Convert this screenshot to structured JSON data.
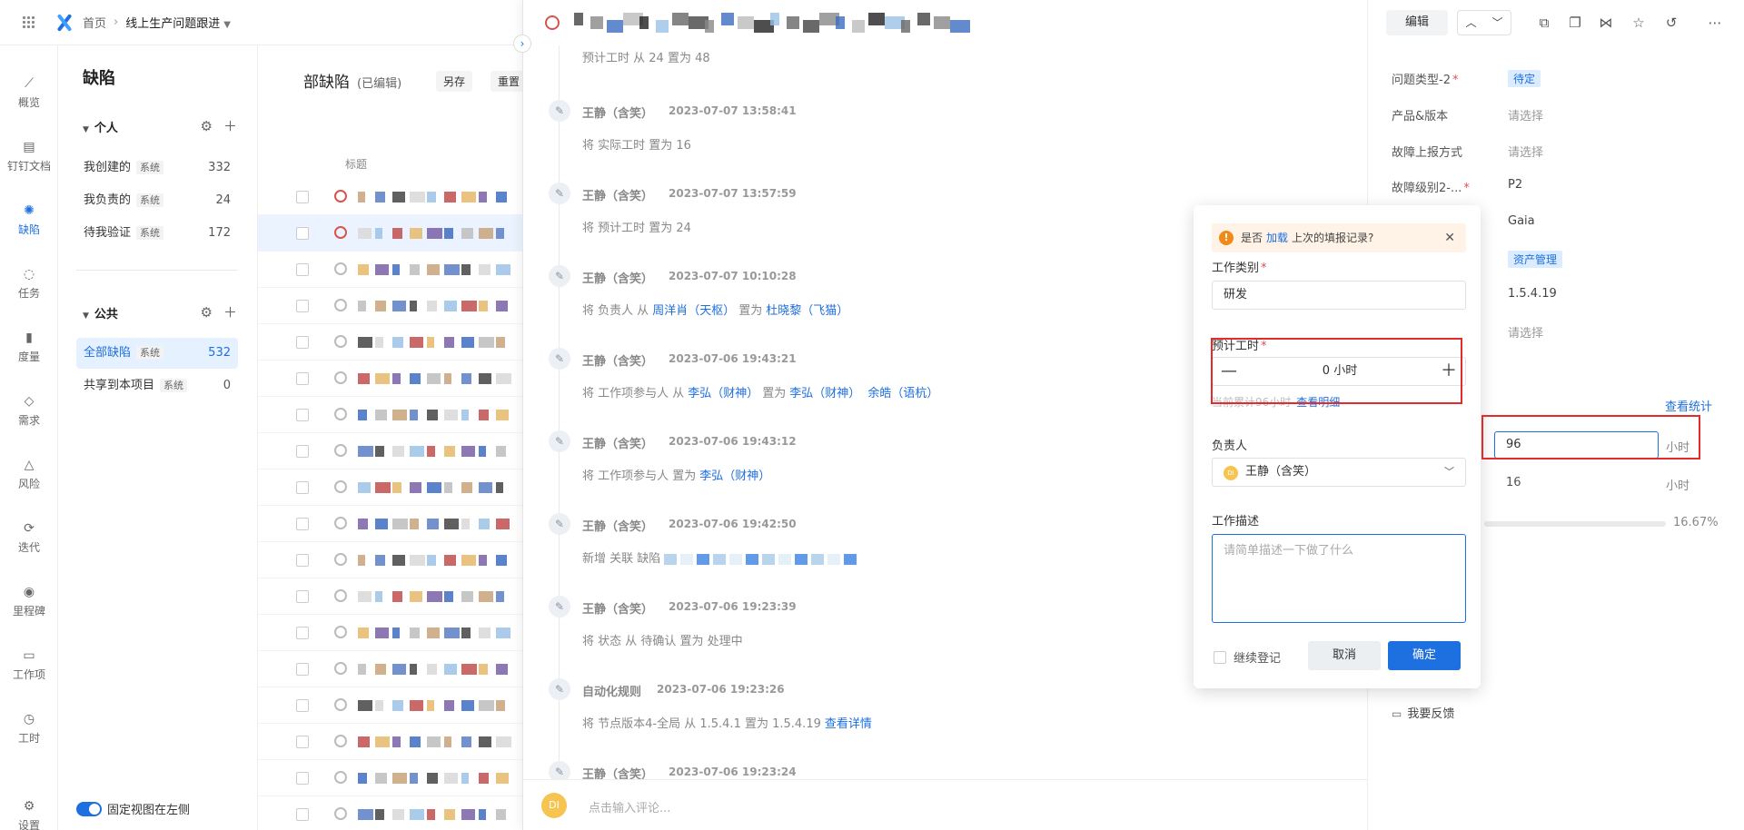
{
  "topbar": {
    "home": "首页",
    "project": "线上生产问题跟进"
  },
  "rail": [
    {
      "label": "概览",
      "icon": "chart-line-icon"
    },
    {
      "label": "钉钉文档",
      "icon": "doc-icon"
    },
    {
      "label": "缺陷",
      "icon": "bug-icon",
      "active": true
    },
    {
      "label": "任务",
      "icon": "lightbulb-icon"
    },
    {
      "label": "度量",
      "icon": "bar-chart-icon"
    },
    {
      "label": "需求",
      "icon": "layers-icon"
    },
    {
      "label": "风险",
      "icon": "warning-icon"
    },
    {
      "label": "迭代",
      "icon": "iteration-icon"
    },
    {
      "label": "里程碑",
      "icon": "milestone-icon"
    },
    {
      "label": "工作项",
      "icon": "folder-icon"
    },
    {
      "label": "工时",
      "icon": "clock-icon"
    },
    {
      "label": "设置",
      "icon": "settings-icon"
    }
  ],
  "nav": {
    "title": "缺陷",
    "personal_group": "个人",
    "public_group": "公共",
    "tag": "系统",
    "personal_items": [
      {
        "label": "我创建的",
        "count": "332"
      },
      {
        "label": "我负责的",
        "count": "24"
      },
      {
        "label": "待我验证",
        "count": "172"
      }
    ],
    "public_items": [
      {
        "label": "全部缺陷",
        "count": "532"
      },
      {
        "label": "共享到本项目",
        "count": "0"
      }
    ],
    "fixed_view": "固定视图在左侧"
  },
  "list": {
    "title": "部缺陷",
    "edited": "(已编辑)",
    "save_as": "另存",
    "reset": "重置",
    "col_title": "标题"
  },
  "activity": [
    {
      "who": "",
      "time": "",
      "text": "预计工时 从 24 置为 48",
      "partial": true
    },
    {
      "who": "王静（含笑）",
      "time": "2023-07-07 13:58:41",
      "pre": "将 实际工时 置为 16"
    },
    {
      "who": "王静（含笑）",
      "time": "2023-07-07 13:57:59",
      "pre": "将 预计工时 置为 24"
    },
    {
      "who": "王静（含笑）",
      "time": "2023-07-07 10:10:28",
      "pre": "将 负责人 从",
      "l1": "周洋肖（天枢）",
      "mid": "置为",
      "l2": "杜晓黎（飞猫）"
    },
    {
      "who": "王静（含笑）",
      "time": "2023-07-06 19:43:21",
      "pre": "将 工作项参与人 从",
      "l1": "李弘（财神）",
      "mid": "置为",
      "l2": "李弘（财神）",
      "l3": "余皓（语杭）"
    },
    {
      "who": "王静（含笑）",
      "time": "2023-07-06 19:43:12",
      "pre": "将 工作项参与人 置为",
      "l1": "李弘（财神）"
    },
    {
      "who": "王静（含笑）",
      "time": "2023-07-06 19:42:50",
      "pre": "新增 关联 缺陷"
    },
    {
      "who": "王静（含笑）",
      "time": "2023-07-06 19:23:39",
      "pre": "将 状态 从 待确认 置为 处理中"
    },
    {
      "who": "自动化规则",
      "time": "2023-07-06 19:23:26",
      "pre": "将 节点版本4-全局 从 1.5.4.1 置为 1.5.4.19",
      "l1": "查看详情",
      "auto": true
    },
    {
      "who": "王静（含笑）",
      "time": "2023-07-06 19:23:24",
      "pre": ""
    }
  ],
  "comment": {
    "avatar": "DI",
    "placeholder": "点击输入评论..."
  },
  "toolbar": {
    "edit": "编辑"
  },
  "props": {
    "rows": [
      {
        "label": "问题类型-2",
        "required": true,
        "value": "待定",
        "style": "badge"
      },
      {
        "label": "产品&版本",
        "value": "请选择",
        "style": "empty"
      },
      {
        "label": "故障上报方式",
        "value": "请选择",
        "style": "empty"
      },
      {
        "label": "故障级别2-...",
        "required": true,
        "value": "P2",
        "style": "dark"
      },
      {
        "label": "",
        "value": "Gaia",
        "style": "dark"
      },
      {
        "label": "",
        "value": "资产管理",
        "style": "badge"
      },
      {
        "label": "",
        "value": "1.5.4.19",
        "style": "dark"
      },
      {
        "label": "",
        "value": "请选择",
        "style": "empty"
      }
    ],
    "view_stats": "查看统计",
    "estimated_hours": "96",
    "actual_hours": "16",
    "unit": "小时",
    "progress": "16.67%",
    "progress_value": 0.1667,
    "feedback": "我要反馈"
  },
  "popover": {
    "notice_pre": "是否",
    "notice_link": "加载",
    "notice_post": "上次的填报记录?",
    "work_type_label": "工作类别",
    "work_type_value": "研发",
    "est_label": "预计工时",
    "est_value": "0 小时",
    "hint": "当前累计96小时",
    "hint_link": "查看明细",
    "owner_label": "负责人",
    "owner_avatar": "DI",
    "owner_value": "王静（含笑）",
    "desc_label": "工作描述",
    "desc_placeholder": "请简单描述一下做了什么",
    "keep": "继续登记",
    "cancel": "取消",
    "ok": "确定"
  }
}
